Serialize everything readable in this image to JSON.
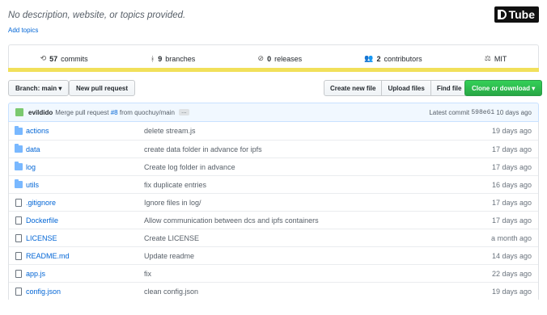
{
  "repo": {
    "description": "No description, website, or topics provided.",
    "add_topics": "Add topics"
  },
  "watermark": {
    "brand": "Tube"
  },
  "stats": [
    {
      "icon": "history-icon",
      "glyph": "⟲",
      "value": "57",
      "label": "commits"
    },
    {
      "icon": "branch-icon",
      "glyph": "ᚼ",
      "value": "9",
      "label": "branches"
    },
    {
      "icon": "tag-icon",
      "glyph": "⊘",
      "value": "0",
      "label": "releases"
    },
    {
      "icon": "people-icon",
      "glyph": "👥",
      "value": "2",
      "label": "contributors"
    },
    {
      "icon": "law-icon",
      "glyph": "⚖",
      "value": "",
      "label": "MIT"
    }
  ],
  "language_bar_color": "#f1e05a",
  "toolbar": {
    "branch_label": "Branch: main ▾",
    "new_pr": "New pull request",
    "create_file": "Create new file",
    "upload_files": "Upload files",
    "find_file": "Find file",
    "clone": "Clone or download ▾"
  },
  "commit": {
    "author": "evildido",
    "message_prefix": "Merge pull request",
    "pr_link": "#8",
    "message_suffix": "from quochuy/main",
    "ellipsis": "…",
    "latest_label": "Latest commit",
    "sha": "598e61",
    "age": "10 days ago"
  },
  "files": [
    {
      "type": "dir",
      "name": "actions",
      "message": "delete stream.js",
      "age": "19 days ago"
    },
    {
      "type": "dir",
      "name": "data",
      "message": "create data folder in advance for ipfs",
      "age": "17 days ago"
    },
    {
      "type": "dir",
      "name": "log",
      "message": "Create log folder in advance",
      "age": "17 days ago"
    },
    {
      "type": "dir",
      "name": "utils",
      "message": "fix duplicate entries",
      "age": "16 days ago"
    },
    {
      "type": "file",
      "name": ".gitignore",
      "message": "Ignore files in log/",
      "age": "17 days ago"
    },
    {
      "type": "file",
      "name": "Dockerfile",
      "message": "Allow communication between dcs and ipfs containers",
      "age": "17 days ago"
    },
    {
      "type": "file",
      "name": "LICENSE",
      "message": "Create LICENSE",
      "age": "a month ago"
    },
    {
      "type": "file",
      "name": "README.md",
      "message": "Update readme",
      "age": "14 days ago"
    },
    {
      "type": "file",
      "name": "app.js",
      "message": "fix",
      "age": "22 days ago"
    },
    {
      "type": "file",
      "name": "config.json",
      "message": "clean config.json",
      "age": "19 days ago"
    }
  ]
}
